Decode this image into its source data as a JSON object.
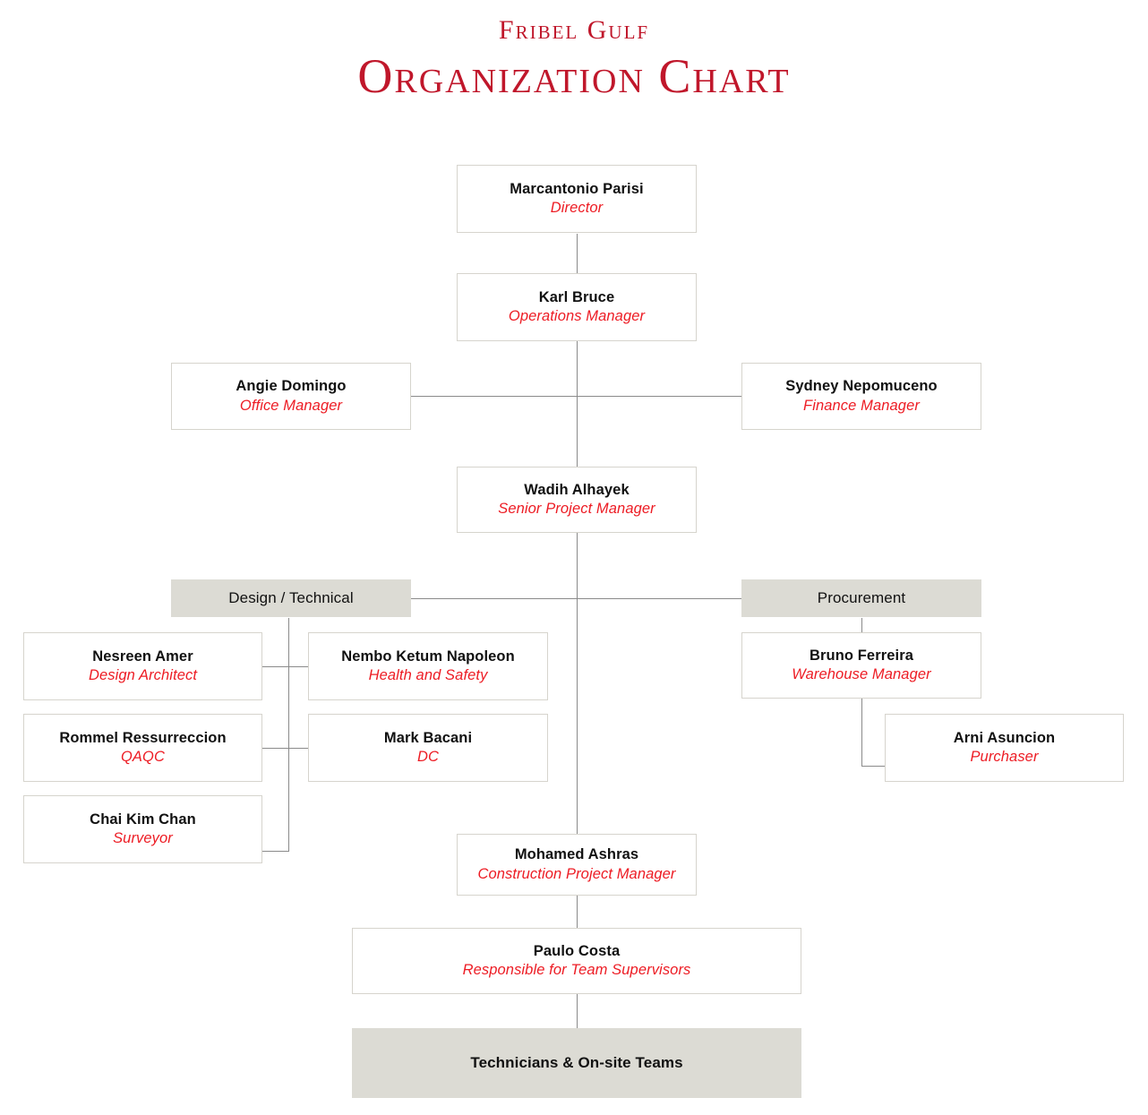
{
  "header": {
    "company": "Fribel Gulf",
    "title": "Organization Chart",
    "title_color": "#C0172B"
  },
  "theme": {
    "role_color": "#ED1C24",
    "name_color": "#111111",
    "box_border": "#d6d4cd",
    "dept_fill": "#DCDBD4",
    "line_color": "#8a8a8a",
    "background": "#ffffff"
  },
  "chart_data": {
    "type": "diagram",
    "title": "Fribel Gulf Organization Chart",
    "nodes": [
      {
        "id": "director",
        "name": "Marcantonio Parisi",
        "role": "Director",
        "kind": "person"
      },
      {
        "id": "operations",
        "name": "Karl Bruce",
        "role": "Operations Manager",
        "kind": "person"
      },
      {
        "id": "office",
        "name": "Angie Domingo",
        "role": "Office Manager",
        "kind": "person"
      },
      {
        "id": "finance",
        "name": "Sydney Nepomuceno",
        "role": "Finance Manager",
        "kind": "person"
      },
      {
        "id": "senior-pm",
        "name": "Wadih Alhayek",
        "role": "Senior Project Manager",
        "kind": "person"
      },
      {
        "id": "design",
        "name": "Design / Technical",
        "role": "",
        "kind": "department"
      },
      {
        "id": "procurement",
        "name": "Procurement",
        "role": "",
        "kind": "department"
      },
      {
        "id": "architect",
        "name": "Nesreen Amer",
        "role": "Design Architect",
        "kind": "person"
      },
      {
        "id": "hse",
        "name": "Nembo Ketum Napoleon",
        "role": "Health and Safety",
        "kind": "person"
      },
      {
        "id": "qaqc",
        "name": "Rommel Ressurreccion",
        "role": "QAQC",
        "kind": "person"
      },
      {
        "id": "dc",
        "name": "Mark Bacani",
        "role": "DC",
        "kind": "person"
      },
      {
        "id": "surveyor",
        "name": "Chai Kim Chan",
        "role": "Surveyor",
        "kind": "person"
      },
      {
        "id": "warehouse",
        "name": "Bruno Ferreira",
        "role": "Warehouse Manager",
        "kind": "person"
      },
      {
        "id": "purchaser",
        "name": "Arni Asuncion",
        "role": "Purchaser",
        "kind": "person"
      },
      {
        "id": "construction-pm",
        "name": "Mohamed Ashras",
        "role": "Construction Project Manager",
        "kind": "person"
      },
      {
        "id": "supervisors",
        "name": "Paulo Costa",
        "role": "Responsible for Team Supervisors",
        "kind": "person"
      },
      {
        "id": "teams",
        "name": "Technicians & On-site Teams",
        "role": "",
        "kind": "group"
      }
    ],
    "edges": [
      {
        "from": "director",
        "to": "operations"
      },
      {
        "from": "operations",
        "to": "office"
      },
      {
        "from": "operations",
        "to": "finance"
      },
      {
        "from": "operations",
        "to": "senior-pm"
      },
      {
        "from": "senior-pm",
        "to": "design"
      },
      {
        "from": "senior-pm",
        "to": "procurement"
      },
      {
        "from": "design",
        "to": "architect"
      },
      {
        "from": "design",
        "to": "hse"
      },
      {
        "from": "design",
        "to": "qaqc"
      },
      {
        "from": "design",
        "to": "dc"
      },
      {
        "from": "design",
        "to": "surveyor"
      },
      {
        "from": "procurement",
        "to": "warehouse"
      },
      {
        "from": "warehouse",
        "to": "purchaser"
      },
      {
        "from": "senior-pm",
        "to": "construction-pm"
      },
      {
        "from": "construction-pm",
        "to": "supervisors"
      },
      {
        "from": "supervisors",
        "to": "teams"
      }
    ]
  }
}
